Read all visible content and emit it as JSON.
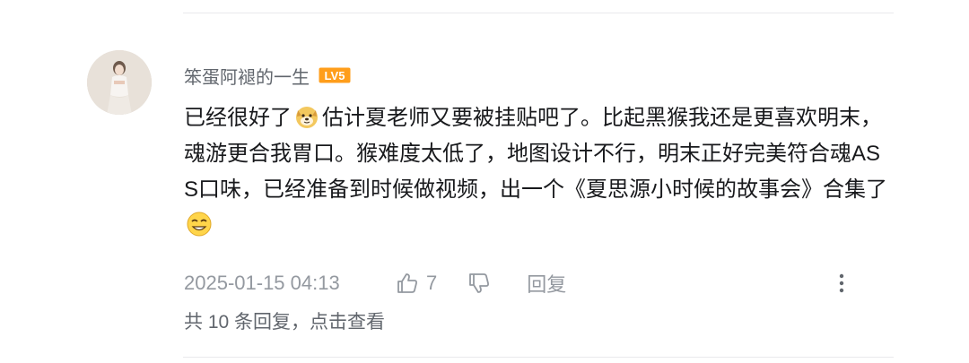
{
  "comment": {
    "username": "笨蛋阿褪的一生",
    "level_badge": "LV5",
    "text_part1": "已经很好了",
    "emoji1": "dog-emoji",
    "text_part2": "估计夏老师又要被挂贴吧了。比起黑猴我还是更喜欢明末，魂游更合我胃口。猴难度太低了，地图设计不行，明末正好完美符合魂ASS口味，已经准备到时候做视频，出一个《夏思源小时候的故事会》合集了",
    "emoji2": "smirk-emoji",
    "timestamp": "2025-01-15 04:13",
    "like_count": "7",
    "reply_label": "回复",
    "replies_summary": "共 10 条回复，点击查看"
  },
  "colors": {
    "text_primary": "#18191c",
    "text_secondary": "#61666d",
    "text_meta": "#9499a0",
    "badge_orange": "#ff9e1b",
    "divider": "#e9e9ec"
  },
  "icons": [
    "thumbs-up-icon",
    "thumbs-down-icon",
    "more-vertical-icon"
  ]
}
